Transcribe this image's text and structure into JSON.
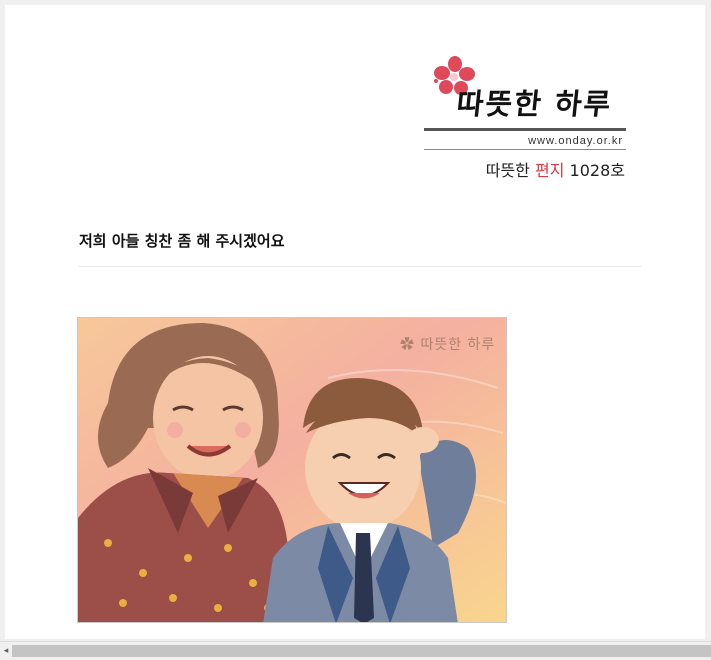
{
  "header": {
    "logo_text": "따뜻한 하루",
    "site_url": "www.onday.or.kr",
    "issue_prefix": "따뜻한",
    "issue_highlight": "편지",
    "issue_number": "1028호",
    "brand_color": "#d43a4a"
  },
  "article": {
    "title": "저희 아들 칭찬 좀 해 주시겠어요"
  },
  "illustration": {
    "watermark_text": "따뜻한 하루",
    "icon": "flower-icon"
  },
  "scrollbar": {
    "left_arrow": "◂"
  }
}
